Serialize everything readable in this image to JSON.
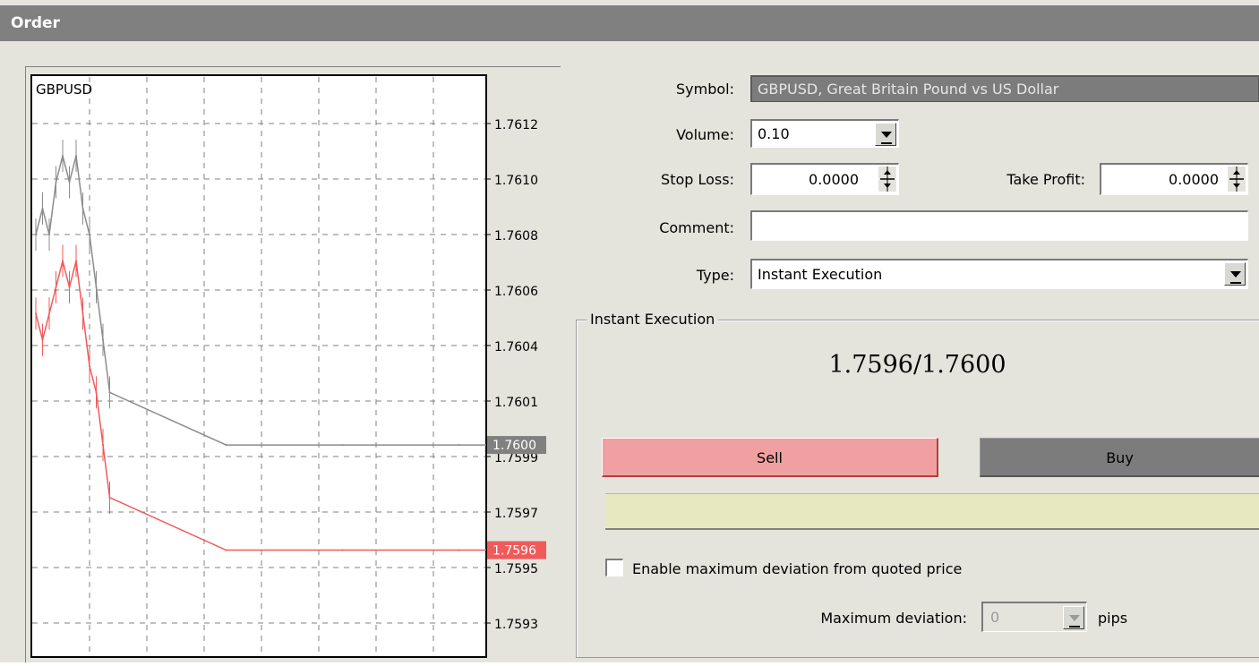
{
  "window": {
    "title": "Order"
  },
  "chart": {
    "symbol": "GBPUSD",
    "bid_line_label": "1.7596",
    "ask_line_label": "1.7600"
  },
  "chart_data": {
    "type": "line",
    "title": "GBPUSD",
    "xlabel": "",
    "ylabel": "",
    "ylim": [
      1.7592,
      1.7614
    ],
    "y_tick_labels": [
      "1.7612",
      "1.7610",
      "1.7608",
      "1.7606",
      "1.7604",
      "1.7601",
      "1.7599",
      "1.7597",
      "1.7595",
      "1.7593"
    ],
    "grid": true,
    "series": [
      {
        "values": [
          1.7608,
          1.7609,
          1.7608,
          1.761,
          1.7611,
          1.761,
          1.7611,
          1.7609,
          1.7608,
          1.7606,
          1.7604,
          1.7602,
          1.76,
          1.76,
          1.76,
          1.76
        ]
      },
      {
        "values": [
          1.7605,
          1.7604,
          1.7605,
          1.7606,
          1.7607,
          1.7606,
          1.7607,
          1.7605,
          1.7603,
          1.7602,
          1.76,
          1.7598,
          1.7596,
          1.7596,
          1.7596,
          1.7596
        ]
      }
    ],
    "bid": 1.7596,
    "ask": 1.76,
    "colors": {
      "ask": "#8c8c8c",
      "bid": "#f05a5a"
    }
  },
  "form": {
    "symbol_label": "Symbol:",
    "symbol_value": "GBPUSD, Great Britain Pound vs US Dollar",
    "volume_label": "Volume:",
    "volume_value": "0.10",
    "stop_loss_label": "Stop Loss:",
    "stop_loss_value": "0.0000",
    "take_profit_label": "Take Profit:",
    "take_profit_value": "0.0000",
    "comment_label": "Comment:",
    "comment_value": "",
    "type_label": "Type:",
    "type_value": "Instant Execution"
  },
  "execution": {
    "group_title": "Instant Execution",
    "quote": "1.7596/1.7600",
    "sell_label": "Sell",
    "buy_label": "Buy",
    "deviation_checkbox_label": "Enable maximum deviation from quoted price",
    "max_deviation_label": "Maximum deviation:",
    "max_deviation_value": "0",
    "pips_label": "pips"
  },
  "colors": {
    "sell": "#f0a0a0",
    "buy": "#7c7c7c",
    "status_bar": "#e8e8c0"
  }
}
